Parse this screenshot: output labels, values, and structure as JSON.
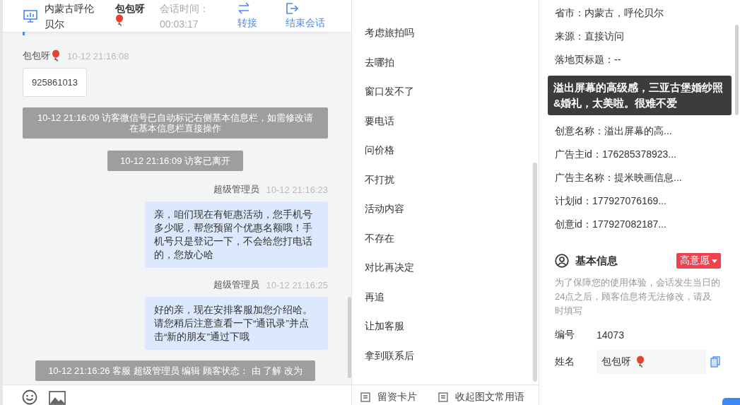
{
  "header": {
    "location": "内蒙古呼伦贝尔",
    "visitor_name": "包包呀",
    "duration_label": "会话时间：",
    "duration": "00:03:17",
    "actions": [
      {
        "label": "转接",
        "kind": "transfer"
      },
      {
        "label": "结束会话",
        "kind": "end"
      }
    ]
  },
  "chat": {
    "messages": [
      {
        "kind": "visitor",
        "sender": "包包呀",
        "time": "10-12 21:16:08",
        "text": "925861013"
      },
      {
        "kind": "system",
        "text": "10-12 21:16:09 访客微信号已自动标记右侧基本信息栏，如需修改请在基本信息栏直接操作"
      },
      {
        "kind": "system",
        "text": "10-12 21:16:09 访客已离开"
      },
      {
        "kind": "agent",
        "sender": "超级管理员",
        "time": "10-12 21:16:23",
        "text": "亲，咱们现在有钜惠活动，您手机号多少呢，帮您预留个优惠名额哦！手机号只是登记一下，不会给您打电话的，您放心哈"
      },
      {
        "kind": "agent",
        "sender": "超级管理员",
        "time": "10-12 21:16:25",
        "text": "好的亲，现在安排客服加您介绍哈。请您稍后注意查看一下“通讯录”并点击“新的朋友”通过下哦"
      },
      {
        "kind": "system",
        "text": "10-12 21:16:26 客服 超级管理员 编辑 顾客状态： 由 了解 改为"
      }
    ]
  },
  "phrases": [
    "考虑旅拍吗",
    "去哪拍",
    "窗口发不了",
    "要电话",
    "问价格",
    "不打扰",
    "活动内容",
    "不存在",
    "对比再决定",
    "再追",
    "让加客服",
    "拿到联系后"
  ],
  "phrase_actions": [
    "留资卡片",
    "收起图文常用语"
  ],
  "info": {
    "rows": [
      "省市：内蒙古，呼伦贝尔",
      "来源：直接访问",
      "落地页标题：--",
      "创意名称：溢出屏幕的高...",
      "广告主id：176285378923...",
      "广告主名称：提米映画信息...",
      "计划id：177927076169...",
      "创意id：177927082187..."
    ],
    "tooltip": "溢出屏幕的高级感，三亚古堡婚纱照&婚礼，太美啦。很难不爱"
  },
  "basic_info": {
    "title": "基本信息",
    "tag": "高意愿",
    "note": "为了保障您的使用体验，会话发生当日的24点之后，顾客信息将无法修改，请及时填写",
    "fields": [
      {
        "kind": "text",
        "label": "编号",
        "value": "14073"
      },
      {
        "kind": "input",
        "label": "姓名",
        "value": "包包呀"
      }
    ]
  }
}
